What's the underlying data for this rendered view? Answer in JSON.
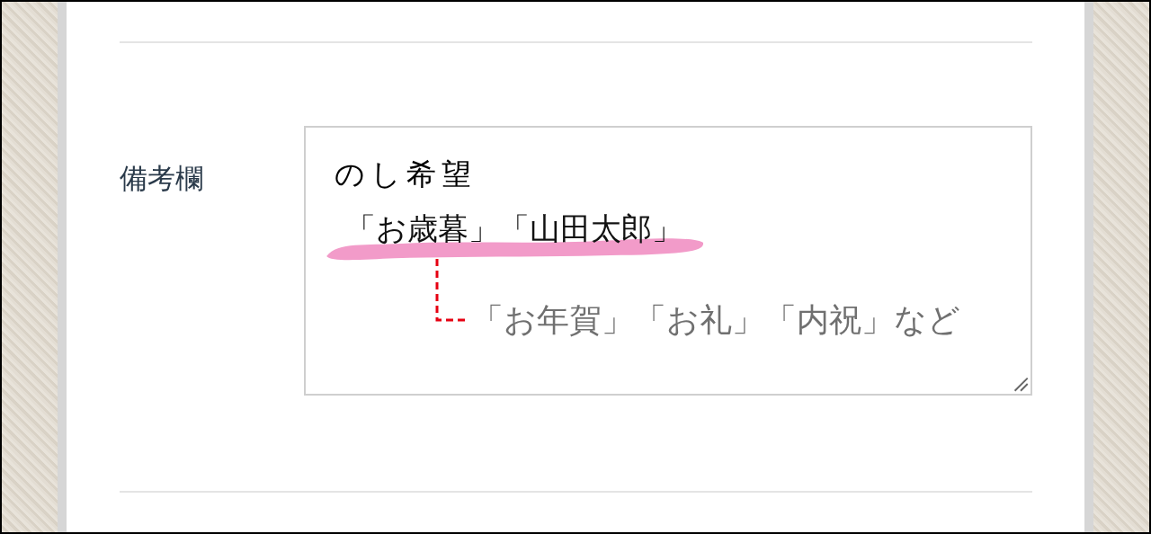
{
  "form": {
    "label": "備考欄",
    "field": {
      "value": "のし希望"
    }
  },
  "annotation": {
    "example": "「お歳暮」「山田太郎」",
    "note": "「お年賀」「お礼」「内祝」など"
  }
}
